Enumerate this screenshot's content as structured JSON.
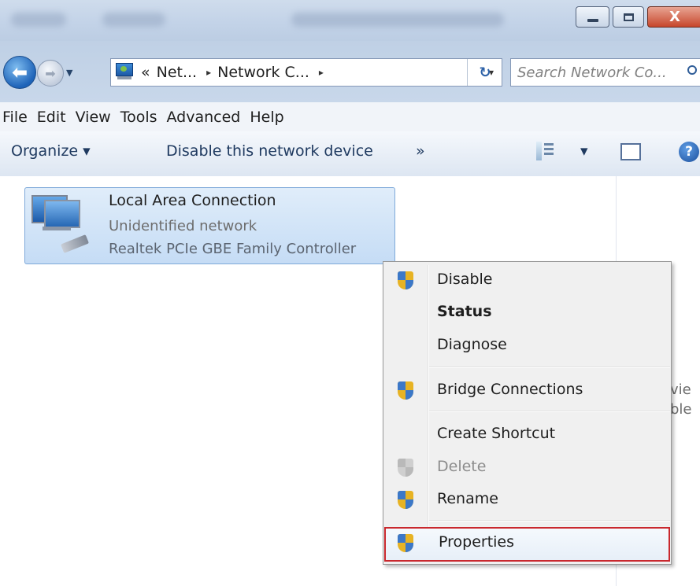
{
  "window": {
    "close_glyph": "X"
  },
  "address_bar": {
    "overflow_chevron": "«",
    "segments": [
      "Net...",
      "Network C..."
    ],
    "separator": "▸",
    "dropdown_glyph": "▾",
    "refresh_glyph": "↻"
  },
  "navigation": {
    "back_glyph": "⬅",
    "forward_glyph": "➡",
    "recent_glyph": "▼"
  },
  "search": {
    "placeholder": "Search Network Co..."
  },
  "menu_bar": [
    "File",
    "Edit",
    "View",
    "Tools",
    "Advanced",
    "Help"
  ],
  "command_bar": {
    "organize": "Organize ▾",
    "disable_device": "Disable this network device",
    "more": "»",
    "view_dropdown": "▾",
    "help_glyph": "?"
  },
  "connection": {
    "name": "Local Area Connection",
    "status": "Unidentified network",
    "adapter": "Realtek PCIe GBE Family Controller"
  },
  "details_pane_fragments": [
    "vie",
    "ble"
  ],
  "context_menu": {
    "items": [
      {
        "label": "Disable",
        "shield": true,
        "bold": false,
        "disabled": false
      },
      {
        "label": "Status",
        "shield": false,
        "bold": true,
        "disabled": false
      },
      {
        "label": "Diagnose",
        "shield": false,
        "bold": false,
        "disabled": false
      },
      {
        "label": "Bridge Connections",
        "shield": true,
        "bold": false,
        "disabled": false
      },
      {
        "label": "Create Shortcut",
        "shield": false,
        "bold": false,
        "disabled": false
      },
      {
        "label": "Delete",
        "shield": true,
        "bold": false,
        "disabled": true
      },
      {
        "label": "Rename",
        "shield": true,
        "bold": false,
        "disabled": false
      },
      {
        "label": "Properties",
        "shield": true,
        "bold": false,
        "disabled": false,
        "highlighted": true
      }
    ]
  },
  "colors": {
    "highlight_border": "#c9282d",
    "tile_selection": "#c5dcf5"
  }
}
